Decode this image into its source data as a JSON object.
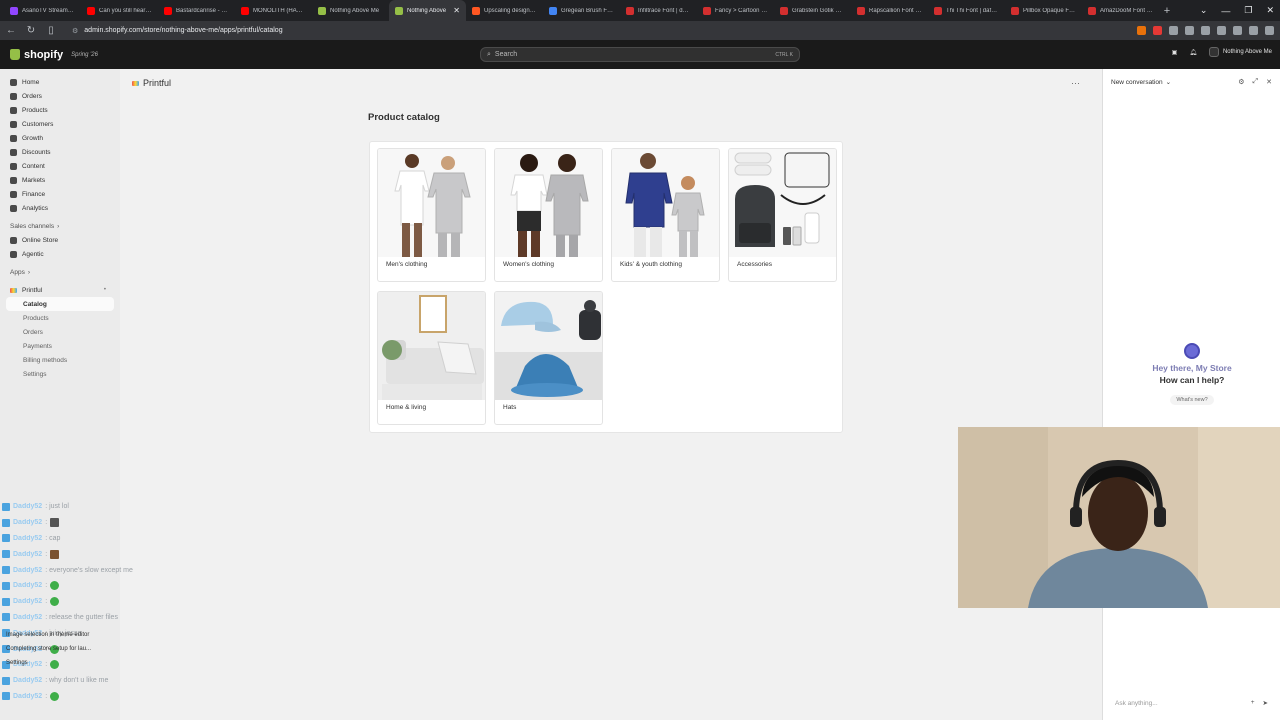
{
  "browser": {
    "tabs": [
      {
        "title": "AsanoTV Stream - ...",
        "color": "#9146ff"
      },
      {
        "title": "Can you still hear m...",
        "color": "#ff0000"
      },
      {
        "title": "Bastardcanrise - Yo...",
        "color": "#ff0000"
      },
      {
        "title": "MONOLITH (HARD...",
        "color": "#ff0000"
      },
      {
        "title": "Nothing Above Me",
        "color": "#95bf47"
      },
      {
        "title": "Nothing Above",
        "color": "#95bf47",
        "active": true
      },
      {
        "title": "Upscaling designs:...",
        "color": "#ff5722"
      },
      {
        "title": "Gregean Brush Fon...",
        "color": "#4285f4"
      },
      {
        "title": "Infiltrace Font | dafo...",
        "color": "#d32f2f"
      },
      {
        "title": "Fancy > Cartoon fo...",
        "color": "#d32f2f"
      },
      {
        "title": "Grabstein Gotik Fo...",
        "color": "#d32f2f"
      },
      {
        "title": "Rapscallion Font | d...",
        "color": "#d32f2f"
      },
      {
        "title": "Thi Thi Font | dafon...",
        "color": "#d32f2f"
      },
      {
        "title": "Pillbox Opaque Fon...",
        "color": "#d32f2f"
      },
      {
        "title": "AmazDooM Font | ...",
        "color": "#d32f2f"
      }
    ],
    "new_tab": "+",
    "url": "admin.shopify.com/store/nothing-above-me/apps/printful/catalog"
  },
  "shopify": {
    "logo": "shopify",
    "edition": "Spring '26",
    "search_placeholder": "Search",
    "search_shortcut": "CTRL  K",
    "store_name": "Nothing Above Me"
  },
  "sidebar": {
    "items": [
      {
        "label": "Home",
        "icon": "home-icon"
      },
      {
        "label": "Orders",
        "icon": "orders-icon"
      },
      {
        "label": "Products",
        "icon": "products-icon"
      },
      {
        "label": "Customers",
        "icon": "customers-icon"
      },
      {
        "label": "Growth",
        "icon": "growth-icon"
      },
      {
        "label": "Discounts",
        "icon": "discounts-icon"
      },
      {
        "label": "Content",
        "icon": "content-icon"
      },
      {
        "label": "Markets",
        "icon": "markets-icon"
      },
      {
        "label": "Finance",
        "icon": "finance-icon"
      },
      {
        "label": "Analytics",
        "icon": "analytics-icon"
      }
    ],
    "sales_channels_label": "Sales channels",
    "channels": [
      {
        "label": "Online Store",
        "icon": "store-icon"
      },
      {
        "label": "Agentic",
        "icon": "agentic-icon"
      }
    ],
    "apps_label": "Apps",
    "app_name": "Printful",
    "app_subitems": [
      "Catalog",
      "Products",
      "Orders",
      "Payments",
      "Billing methods",
      "Settings"
    ]
  },
  "main": {
    "app_title": "Printful",
    "more": "···",
    "catalog_title": "Product catalog",
    "categories": [
      "Men's clothing",
      "Women's clothing",
      "Kids' & youth clothing",
      "Accessories",
      "Home & living",
      "Hats"
    ]
  },
  "assistant": {
    "header": "New conversation",
    "greeting_line1": "Hey there, My Store",
    "greeting_line2": "How can I help?",
    "whats_new": "What's new?",
    "input_placeholder": "Ask anything..."
  },
  "chat": [
    {
      "user": "Daddy52",
      "msg": ": just lol",
      "emote": null
    },
    {
      "user": "Daddy52",
      "msg": ":",
      "emote": "sq"
    },
    {
      "user": "Daddy52",
      "msg": ": cap",
      "emote": null
    },
    {
      "user": "Daddy52",
      "msg": ":",
      "emote": "br"
    },
    {
      "user": "Daddy52",
      "msg": ": everyone's slow except me",
      "emote": null
    },
    {
      "user": "Daddy52",
      "msg": ":",
      "emote": "g"
    },
    {
      "user": "Daddy52",
      "msg": ":",
      "emote": "g"
    },
    {
      "user": "Daddy52",
      "msg": ": release the gutter files",
      "emote": null
    },
    {
      "user": "Daddy52",
      "msg": ": juicy jesse",
      "emote": null
    },
    {
      "user": "Daddy52",
      "msg": ":",
      "emote": "g"
    },
    {
      "user": "Daddy52",
      "msg": ":",
      "emote": "g"
    },
    {
      "user": "Daddy52",
      "msg": ": why don't u like me",
      "emote": null
    },
    {
      "user": "Daddy52",
      "msg": ":",
      "emote": "g"
    }
  ],
  "overlay_notes": [
    "Image selection in theme editor",
    "Completing store setup for lau...",
    "Settings"
  ]
}
